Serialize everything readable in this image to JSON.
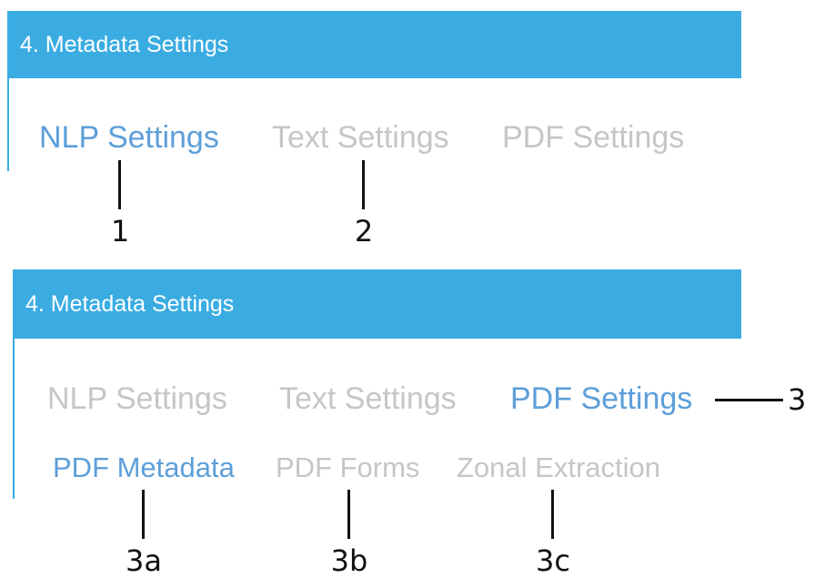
{
  "panel_top": {
    "header_title": "4. Metadata Settings",
    "tabs": [
      {
        "label": "NLP Settings",
        "active": true
      },
      {
        "label": "Text Settings",
        "active": false
      },
      {
        "label": "PDF Settings",
        "active": false
      }
    ]
  },
  "panel_bottom": {
    "header_title": "4. Metadata Settings",
    "tabs": [
      {
        "label": "NLP Settings",
        "active": false
      },
      {
        "label": "Text Settings",
        "active": false
      },
      {
        "label": "PDF Settings",
        "active": true
      }
    ],
    "subtabs": [
      {
        "label": "PDF Metadata",
        "active": true
      },
      {
        "label": "PDF Forms",
        "active": false
      },
      {
        "label": "Zonal Extraction",
        "active": false
      }
    ]
  },
  "callouts": {
    "c1": "1",
    "c2": "2",
    "c3": "3",
    "c3a": "3a",
    "c3b": "3b",
    "c3c": "3c"
  },
  "colors": {
    "header_bg": "#3aace2",
    "active_tab": "#5d9fd9",
    "inactive_tab": "#c6c6c6"
  }
}
